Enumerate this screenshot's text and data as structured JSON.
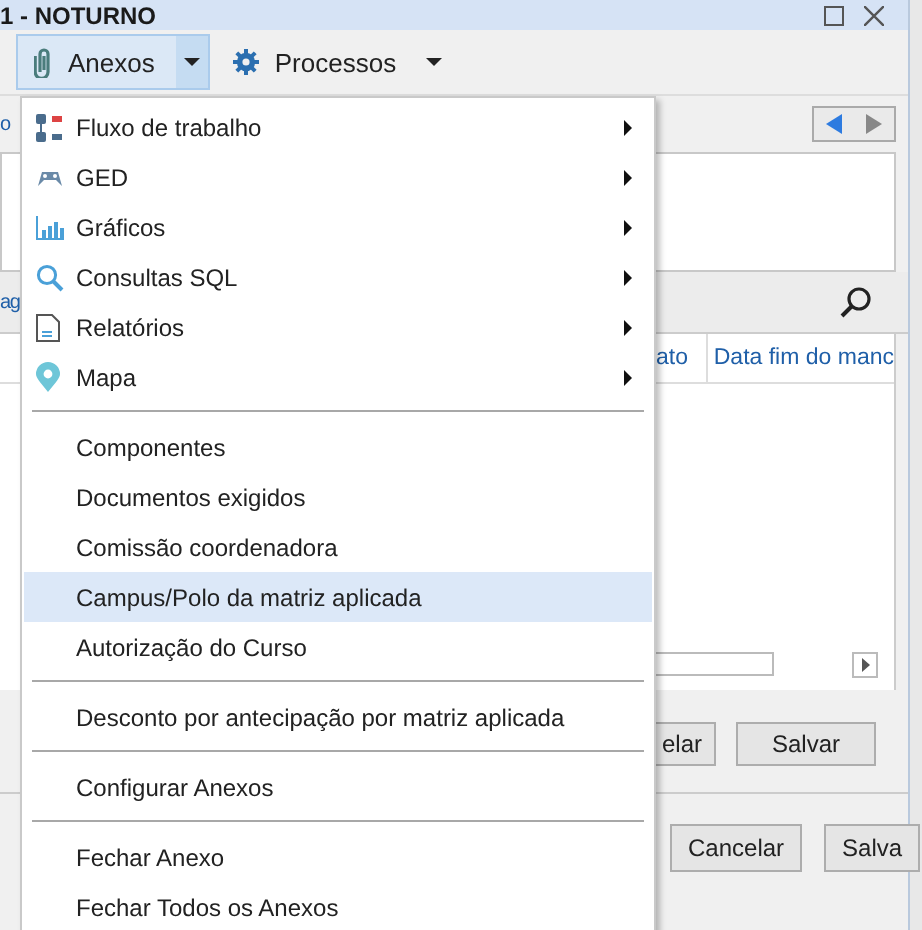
{
  "window": {
    "title": "1 - NOTURNO"
  },
  "toolbar": [
    {
      "label": "Anexos",
      "kind": "split",
      "pressed": true
    },
    {
      "label": "Processos",
      "kind": "split",
      "pressed": false
    }
  ],
  "form": {
    "left_label": "o",
    "tab_label": "ag",
    "table_columns": [
      "ato",
      "Data fim do manc"
    ],
    "inner_buttons": [
      "elar",
      "Salvar"
    ],
    "outer_buttons": [
      "Cancelar",
      "Salva"
    ]
  },
  "menu": {
    "items": [
      {
        "kind": "item",
        "label": "Fluxo de trabalho",
        "submenu": true,
        "selected": false
      },
      {
        "kind": "item",
        "label": "GED",
        "submenu": true,
        "selected": false
      },
      {
        "kind": "item",
        "label": "Gráficos",
        "submenu": true,
        "selected": false
      },
      {
        "kind": "item",
        "label": "Consultas SQL",
        "submenu": true,
        "selected": false
      },
      {
        "kind": "item",
        "label": "Relatórios",
        "submenu": true,
        "selected": false
      },
      {
        "kind": "item",
        "label": "Mapa",
        "submenu": true,
        "selected": false
      },
      {
        "kind": "separator"
      },
      {
        "kind": "item",
        "label": "Componentes",
        "submenu": false,
        "selected": false
      },
      {
        "kind": "item",
        "label": "Documentos exigidos",
        "submenu": false,
        "selected": false
      },
      {
        "kind": "item",
        "label": "Comissão coordenadora",
        "submenu": false,
        "selected": false
      },
      {
        "kind": "item",
        "label": "Campus/Polo da matriz aplicada",
        "submenu": false,
        "selected": true
      },
      {
        "kind": "item",
        "label": "Autorização do Curso",
        "submenu": false,
        "selected": false
      },
      {
        "kind": "separator"
      },
      {
        "kind": "item",
        "label": "Desconto por antecipação por matriz aplicada",
        "submenu": false,
        "selected": false
      },
      {
        "kind": "separator"
      },
      {
        "kind": "item",
        "label": "Configurar Anexos",
        "submenu": false,
        "selected": false
      },
      {
        "kind": "separator"
      },
      {
        "kind": "item",
        "label": "Fechar Anexo",
        "submenu": false,
        "selected": false
      },
      {
        "kind": "item",
        "label": "Fechar Todos os Anexos",
        "submenu": false,
        "selected": false
      }
    ]
  }
}
